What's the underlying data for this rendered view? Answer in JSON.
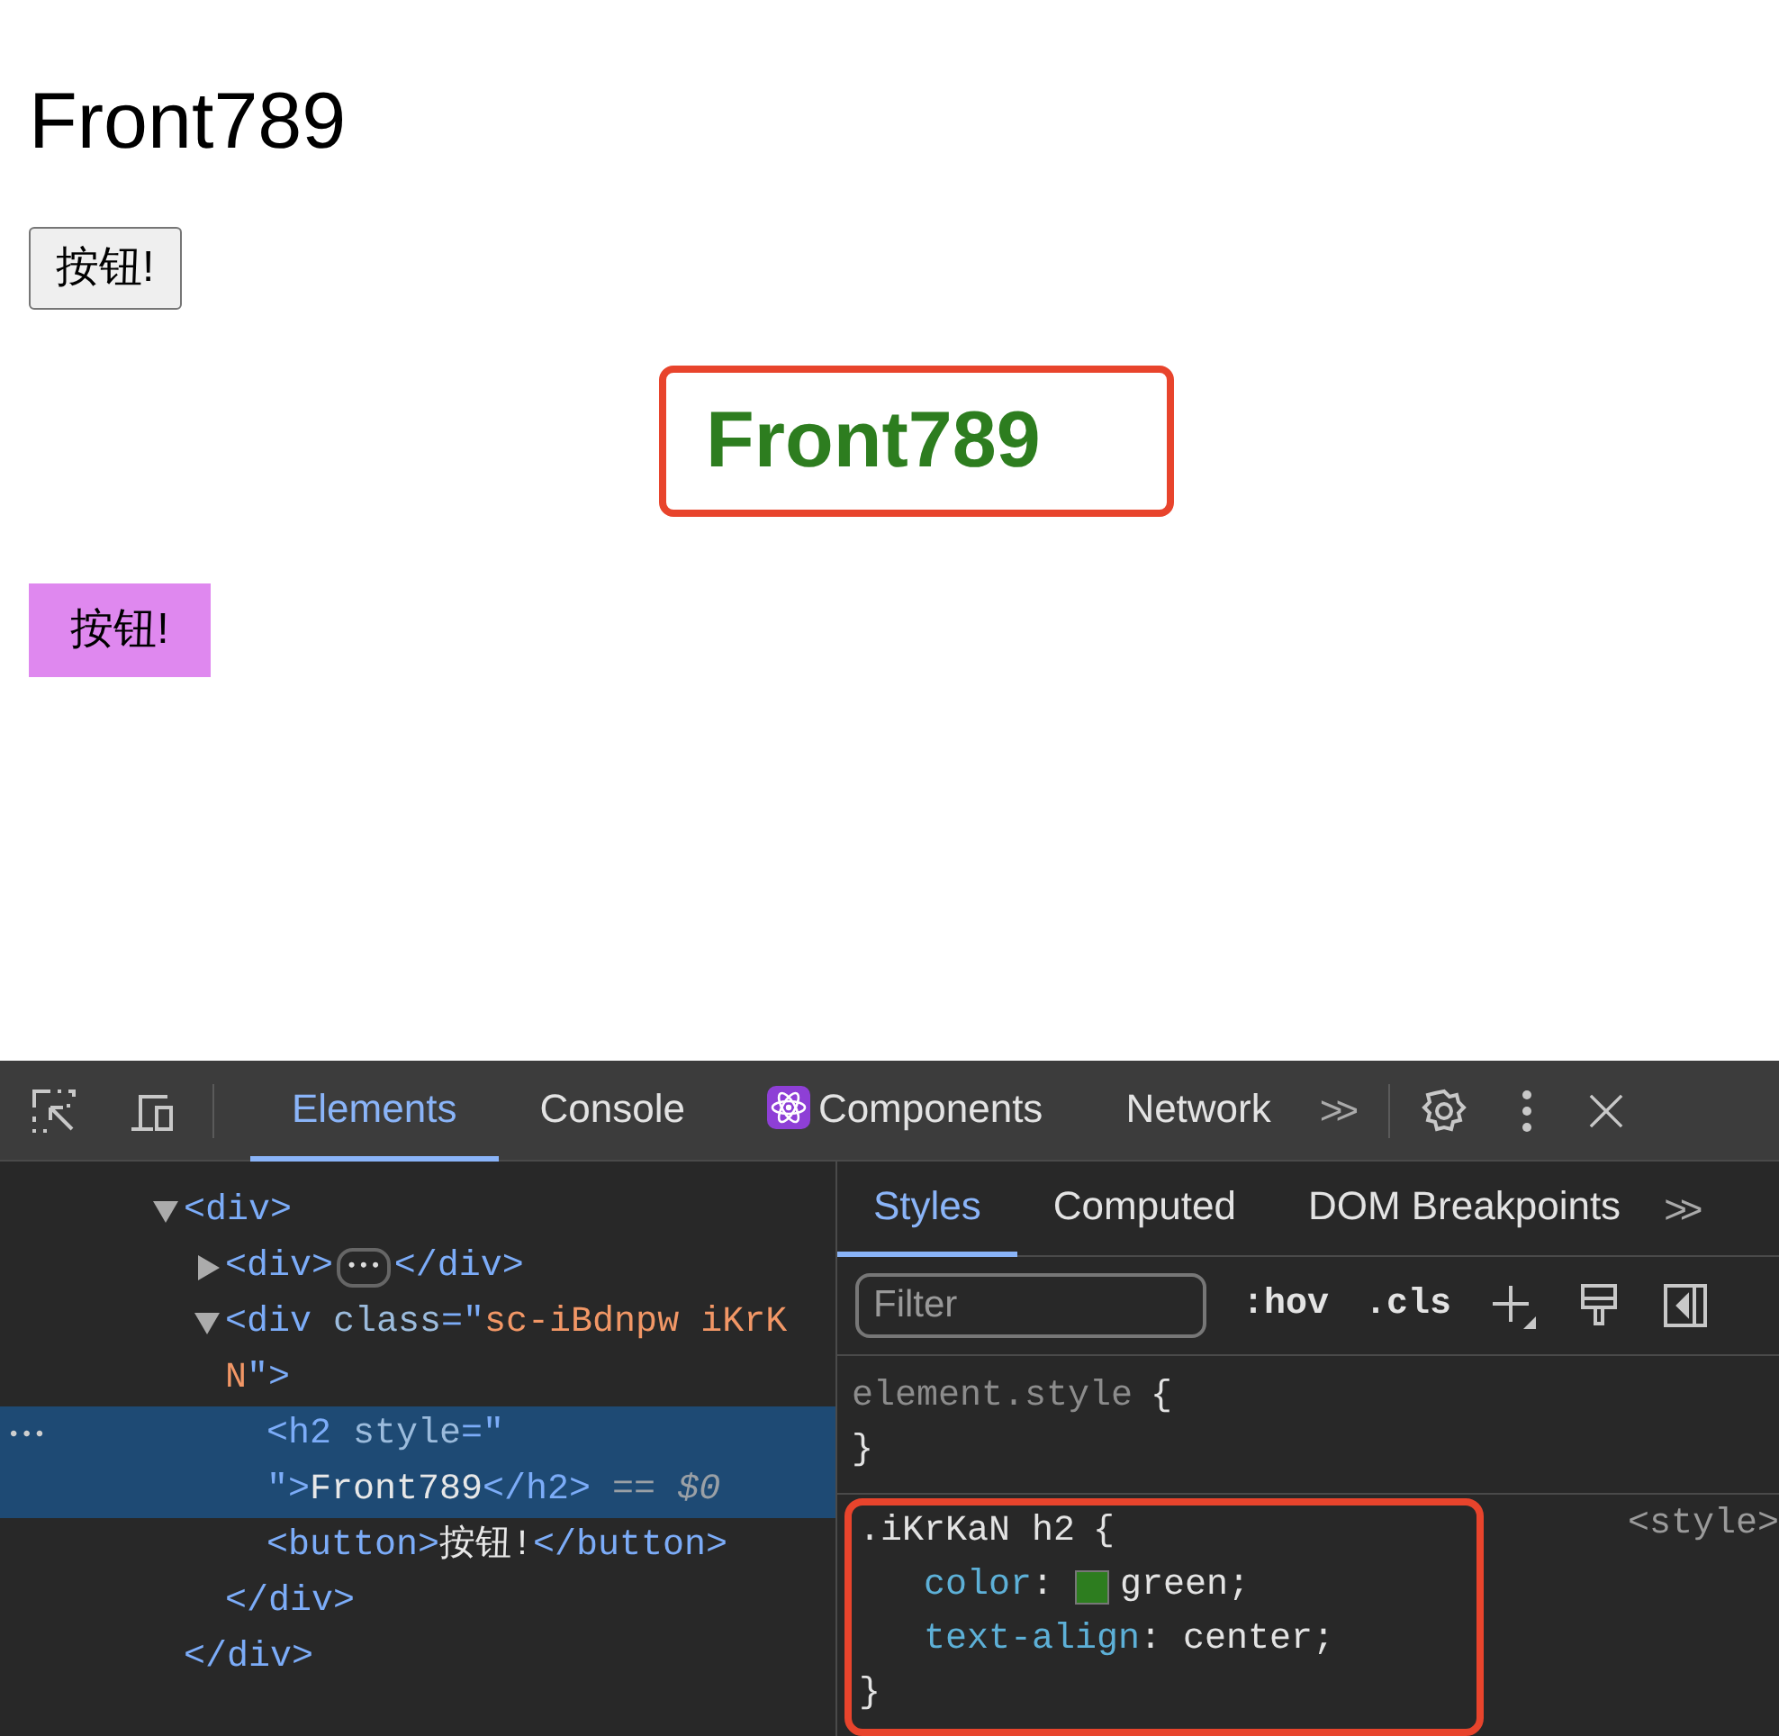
{
  "page": {
    "heading": "Front789",
    "plain_button": "按钮!",
    "styled_heading": {
      "text": "Front789",
      "highlighted": true
    },
    "styled_button": "按钮!"
  },
  "devtools": {
    "tabs": [
      {
        "label": "Elements",
        "selected": true,
        "kind": "text"
      },
      {
        "label": "Console",
        "selected": false,
        "kind": "text"
      },
      {
        "label": "Components",
        "selected": false,
        "kind": "react"
      },
      {
        "label": "Network",
        "selected": false,
        "kind": "text"
      }
    ],
    "more_tabs": ">>",
    "tree": [
      {
        "expanded": true,
        "selected": false,
        "lines": [
          [
            {
              "kind": "tag",
              "text": "<div>"
            }
          ]
        ],
        "close": [
          {
            "kind": "tag",
            "text": "</div>"
          }
        ],
        "children": [
          {
            "expanded": false,
            "selected": false,
            "lines": [
              [
                {
                  "kind": "tag",
                  "text": "<div>"
                },
                {
                  "kind": "ellipsis",
                  "text": "•••"
                },
                {
                  "kind": "tag",
                  "text": "</div>"
                }
              ]
            ]
          },
          {
            "expanded": true,
            "selected": false,
            "lines": [
              [
                {
                  "kind": "tag",
                  "text": "<div "
                },
                {
                  "kind": "attr",
                  "text": "class"
                },
                {
                  "kind": "tag",
                  "text": "=\""
                },
                {
                  "kind": "value",
                  "text": "sc-iBdnpw iKrK"
                }
              ],
              [
                {
                  "kind": "value",
                  "text": "N"
                },
                {
                  "kind": "tag",
                  "text": "\">"
                }
              ]
            ],
            "close": [
              {
                "kind": "tag",
                "text": "</div>"
              }
            ],
            "children": [
              {
                "selected": true,
                "gutter": "•••",
                "lines": [
                  [
                    {
                      "kind": "tag",
                      "text": "<h2 "
                    },
                    {
                      "kind": "attr",
                      "text": "style"
                    },
                    {
                      "kind": "tag",
                      "text": "=\""
                    }
                  ],
                  [
                    {
                      "kind": "tag",
                      "text": "\">"
                    },
                    {
                      "kind": "text",
                      "text": "Front789"
                    },
                    {
                      "kind": "tag",
                      "text": "</h2>"
                    },
                    {
                      "kind": "dim",
                      "text": " == "
                    },
                    {
                      "kind": "var",
                      "text": "$0"
                    }
                  ]
                ]
              },
              {
                "selected": false,
                "lines": [
                  [
                    {
                      "kind": "tag",
                      "text": "<button>"
                    },
                    {
                      "kind": "text",
                      "text": "按钮!"
                    },
                    {
                      "kind": "tag",
                      "text": "</button>"
                    }
                  ]
                ]
              }
            ]
          }
        ]
      }
    ],
    "style_tabs": [
      {
        "label": "Styles",
        "selected": true
      },
      {
        "label": "Computed",
        "selected": false
      },
      {
        "label": "DOM Breakpoints",
        "selected": false
      }
    ],
    "style_more": ">>",
    "filter": {
      "placeholder": "Filter"
    },
    "hov": ":hov",
    "cls": ".cls",
    "element_style": {
      "selector": "element.style",
      "open": "{",
      "close": "}"
    },
    "rule": {
      "selector": ".iKrKaN h2",
      "open": "{",
      "source": "<style>",
      "highlighted": true,
      "close": "}",
      "declarations": [
        {
          "property": "color",
          "colon": ":",
          "value": "green;",
          "color": "#2d7d1f"
        },
        {
          "property": "text-align",
          "colon": ":",
          "value": "center;"
        }
      ]
    }
  }
}
